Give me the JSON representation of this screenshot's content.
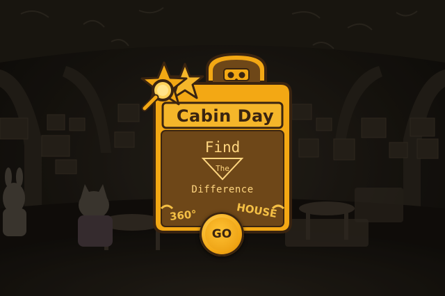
{
  "title": "Cabin Day",
  "subtitle": {
    "find": "Find",
    "the": "The",
    "difference": "Difference"
  },
  "badge": {
    "left": "360°",
    "right": "HOUSE"
  },
  "go_label": "GO",
  "icons": {
    "stars": "star-icon",
    "search": "magnifier-icon",
    "vr": "vr-headset-icon"
  },
  "colors": {
    "frame_orange": "#f3a814",
    "frame_dark": "#3a2410",
    "panel_brown": "#6e4718",
    "text_gold": "#ffd680"
  }
}
